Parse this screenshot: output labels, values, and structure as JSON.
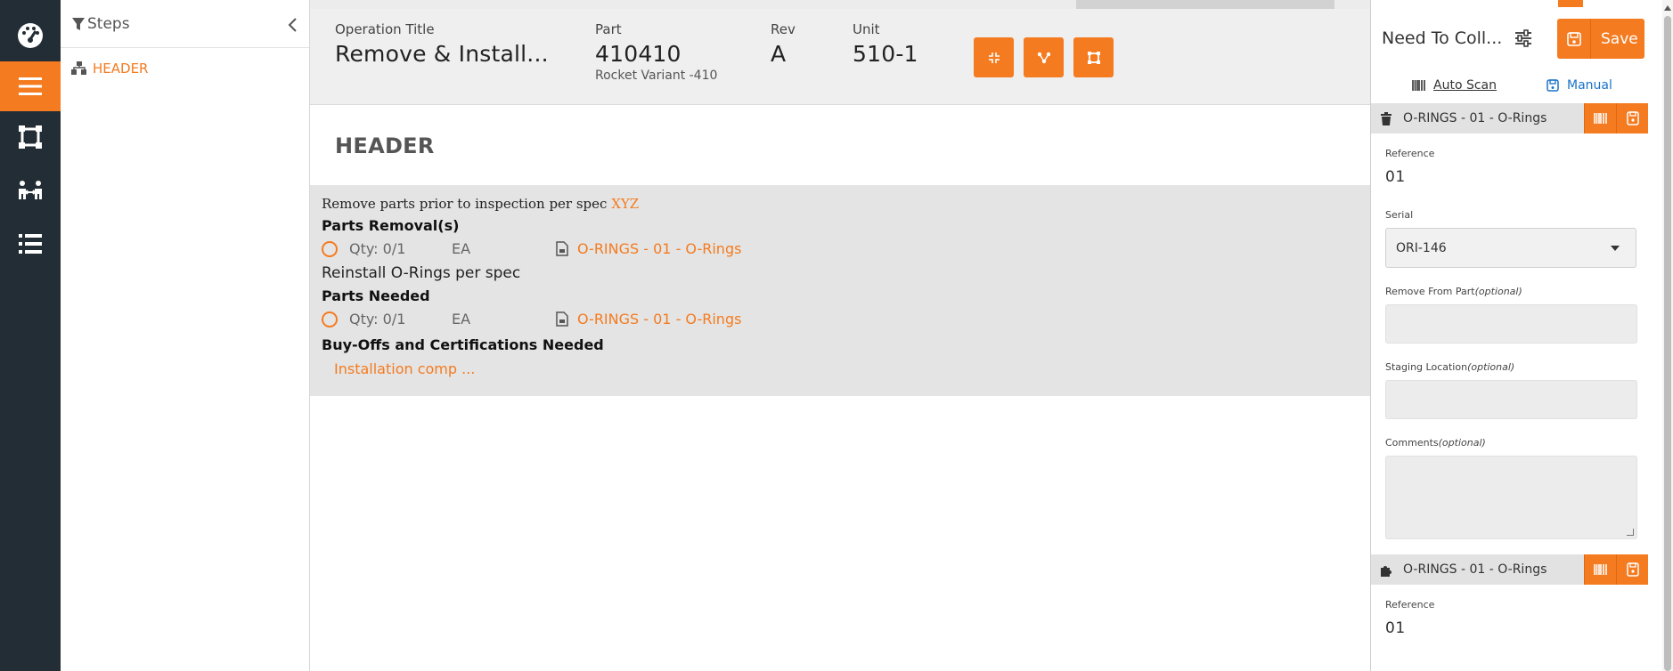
{
  "rail": {
    "items": [
      {
        "icon": "dashboard-icon"
      },
      {
        "icon": "menu-icon",
        "active": true
      },
      {
        "icon": "frame-icon"
      },
      {
        "icon": "people-icon"
      },
      {
        "icon": "list-icon"
      }
    ]
  },
  "steps": {
    "title": "Steps",
    "items": [
      {
        "label": "HEADER",
        "icon": "hierarchy-icon"
      }
    ]
  },
  "operation": {
    "title_label": "Operation Title",
    "title_value": "Remove & Install...",
    "part_label": "Part",
    "part_value": "410410",
    "part_sub": "Rocket Variant -410",
    "rev_label": "Rev",
    "rev_value": "A",
    "unit_label": "Unit",
    "unit_value": "510-1",
    "buttons": [
      "collapse-icon",
      "share-icon",
      "frame-icon"
    ]
  },
  "content": {
    "header": "HEADER",
    "intro_text": "Remove parts prior to inspection per spec ",
    "intro_link": "XYZ",
    "parts_removal_label": "Parts Removal(s)",
    "removal_row": {
      "qty": "Qty: 0/1",
      "uom": "EA",
      "part": "O-RINGS - 01 - O-Rings"
    },
    "reinstall_text": "Reinstall O-Rings per spec",
    "parts_needed_label": "Parts Needed",
    "needed_row": {
      "qty": "Qty: 0/1",
      "uom": "EA",
      "part": "O-RINGS - 01 - O-Rings"
    },
    "buyoffs_label": "Buy-Offs and Certifications Needed",
    "buyoff_link": "Installation comp ..."
  },
  "right_panel": {
    "title": "Need To Coll...",
    "save_label": "Save",
    "auto_scan": "Auto Scan",
    "manual": "Manual",
    "item1": {
      "header": "O-RINGS - 01 - O-Rings",
      "reference_label": "Reference",
      "reference_value": "01",
      "serial_label": "Serial",
      "serial_value": "ORI-146",
      "remove_from_label": "Remove From Part",
      "staging_label": "Staging Location",
      "comments_label": "Comments",
      "optional": "(optional)"
    },
    "item2": {
      "header": "O-RINGS - 01 - O-Rings",
      "reference_label": "Reference",
      "reference_value": "01"
    }
  },
  "colors": {
    "accent": "#f47b20",
    "rail": "#232d35",
    "link_blue": "#1a73c8"
  }
}
